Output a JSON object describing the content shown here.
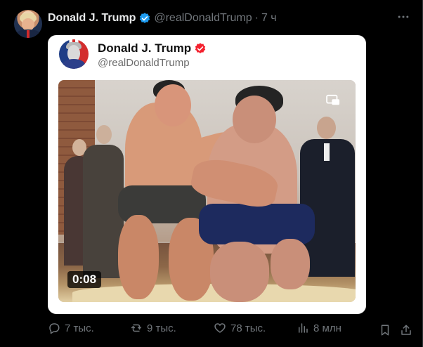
{
  "tweet": {
    "author_name": "Donald J. Trump",
    "author_handle": "@realDonaldTrump",
    "separator": "·",
    "time": "7 ч",
    "more_icon": "more-horizontal-icon"
  },
  "embedded_card": {
    "author_name": "Donald J. Trump",
    "author_handle": "@realDonaldTrump",
    "verified_color": "#f4212e",
    "media": {
      "type": "video",
      "duration": "0:08",
      "icon": "media-gallery-icon"
    }
  },
  "actions": {
    "reply_count": "7 тыс.",
    "repost_count": "9 тыс.",
    "like_count": "78 тыс.",
    "views_count": "8 млн"
  },
  "colors": {
    "background": "#000000",
    "text_primary": "#e7e9ea",
    "text_secondary": "#71767b",
    "verified_blue": "#1d9bf0",
    "card_background": "#ffffff"
  }
}
